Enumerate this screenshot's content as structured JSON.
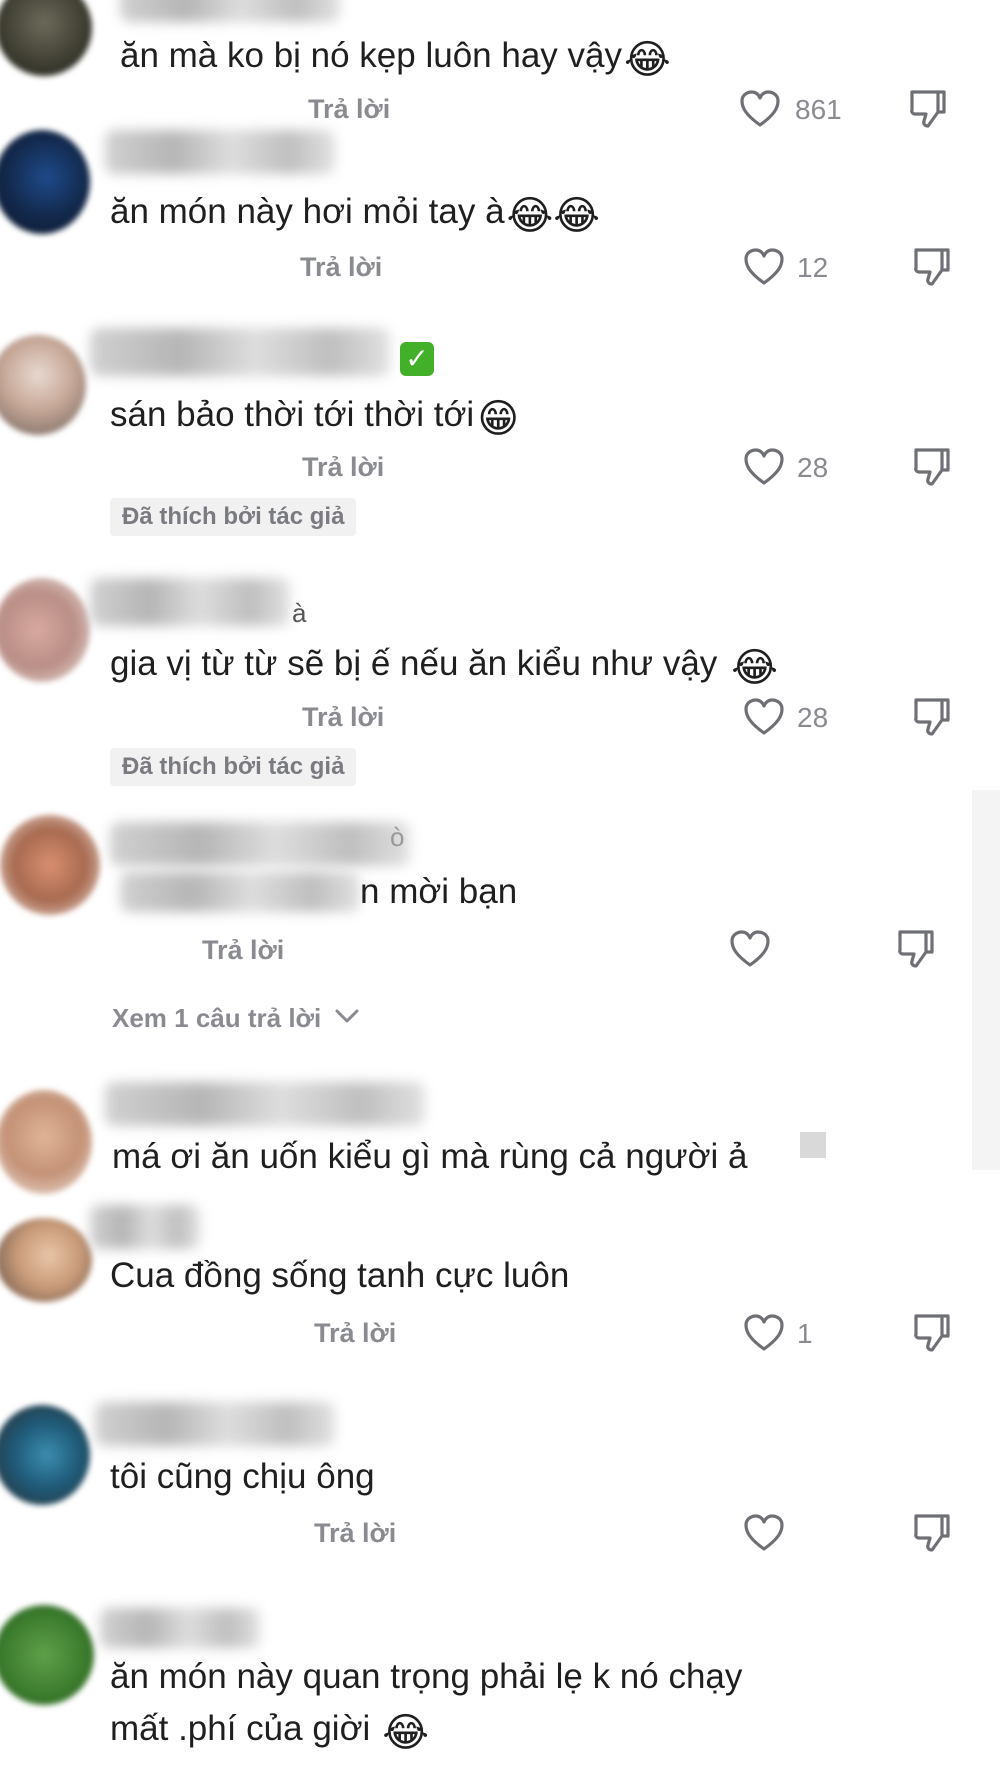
{
  "reply_label": "Trả lời",
  "liked_by_author": "Đã thích bởi tác giả",
  "comments": [
    {
      "text": "ăn mà ko bị nó kẹp luôn hay vậy",
      "emojis": "😂",
      "likes": "861"
    },
    {
      "text": "ăn món này hơi mỏi tay à",
      "emojis": "😂😂",
      "likes": "12"
    },
    {
      "text": "sán bảo thời tới thời tới",
      "emojis": "😁",
      "likes": "28"
    },
    {
      "text": "gia vị từ từ sẽ bị ế nếu ăn kiểu như vậy",
      "emojis": "😂",
      "likes": "28",
      "name_tail": "à"
    },
    {
      "text": "n mời bạn",
      "emojis": "",
      "likes": "",
      "more_replies": "Xem 1 câu trả lời",
      "name_tail": "ò"
    },
    {
      "text": "má ơi ăn uốn kiểu gì mà rùng cả người ả",
      "emojis": "",
      "likes": ""
    },
    {
      "text": "Cua đồng sống tanh cực luôn",
      "emojis": "",
      "likes": "1"
    },
    {
      "text": "tôi cũng chịu ông",
      "emojis": "",
      "likes": ""
    },
    {
      "text_line1": "ăn món này quan trọng phải lẹ k nó chạy",
      "text_line2": "mất .phí của giời",
      "emojis": "😂"
    }
  ],
  "icons": [
    "heart-icon",
    "dislike-icon",
    "chevron-down-icon",
    "verified-icon"
  ],
  "colors": {
    "text": "#1f1f1f",
    "muted": "#8a8b91",
    "verified": "#43b02a",
    "tag_bg": "#f1f1f2"
  }
}
